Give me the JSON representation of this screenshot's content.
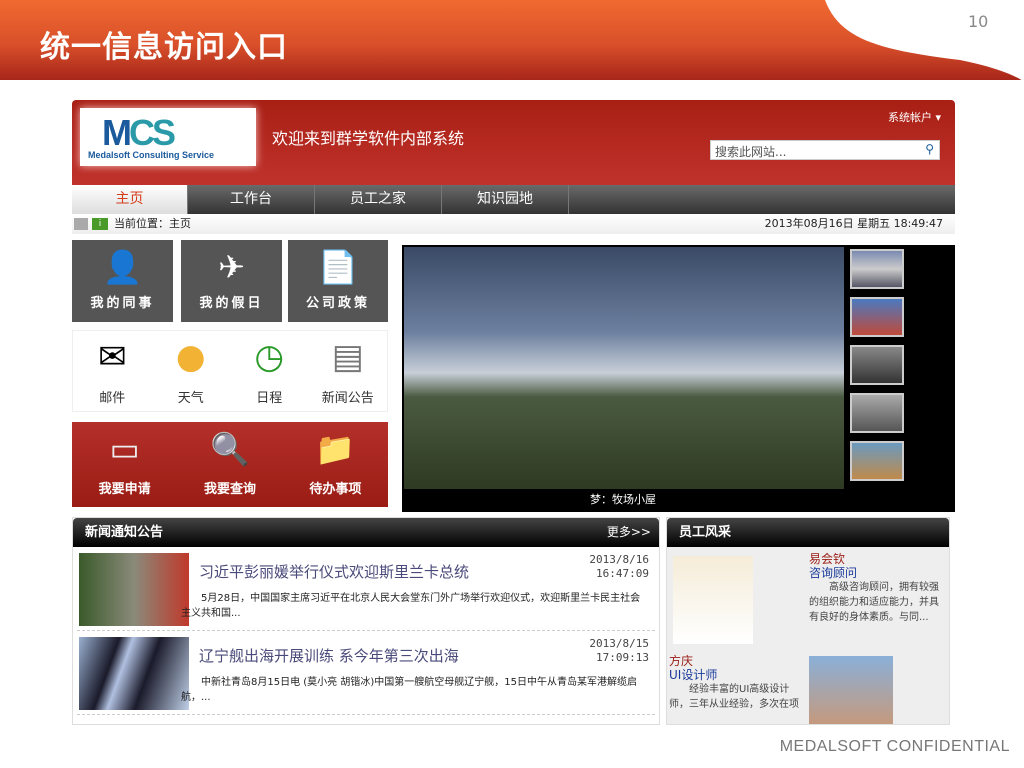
{
  "slide": {
    "title": "统一信息访问入口",
    "page_number": "10",
    "footer": "MEDALSOFT CONFIDENTIAL"
  },
  "header": {
    "logo_text": "Medalsoft Consulting Service",
    "welcome": "欢迎来到群学软件内部系统",
    "account": "系统帐户 ▾",
    "search_placeholder": "搜索此网站..."
  },
  "nav": [
    "主页",
    "工作台",
    "员工之家",
    "知识园地"
  ],
  "breadcrumb": {
    "location": "当前位置：主页",
    "datetime": "2013年08月16日 星期五 18:49:47"
  },
  "tiles": [
    {
      "label": "我的同事",
      "icon": "person-icon"
    },
    {
      "label": "我的假日",
      "icon": "airplane-icon"
    },
    {
      "label": "公司政策",
      "icon": "document-icon"
    }
  ],
  "apps": [
    {
      "label": "邮件"
    },
    {
      "label": "天气"
    },
    {
      "label": "日程"
    },
    {
      "label": "新闻公告"
    }
  ],
  "actions": [
    {
      "label": "我要申请"
    },
    {
      "label": "我要查询"
    },
    {
      "label": "待办事项"
    }
  ],
  "slideshow": {
    "caption": "梦：牧场小屋"
  },
  "news": {
    "title": "新闻通知公告",
    "more": "更多>>",
    "items": [
      {
        "title": "习近平彭丽媛举行仪式欢迎斯里兰卡总统",
        "date": "2013/8/16",
        "time": "16:47:09",
        "summary": "5月28日，中国国家主席习近平在北京人民大会堂东门外广场举行欢迎仪式，欢迎斯里兰卡民主社会主义共和国..."
      },
      {
        "title": "辽宁舰出海开展训练 系今年第三次出海",
        "date": "2013/8/15",
        "time": "17:09:13",
        "summary": "中新社青岛8月15日电 (莫小亮 胡锴冰)中国第一艘航空母舰辽宁舰，15日中午从青岛某军港解缆启航，..."
      }
    ]
  },
  "staff": {
    "title": "员工风采",
    "people": [
      {
        "name": "易会钦",
        "role": "咨询顾问",
        "desc": "高级咨询顾问，拥有较强的组织能力和适应能力，并具有良好的身体素质。与同..."
      },
      {
        "name": "方庆",
        "role": "UI设计师",
        "desc": "经验丰富的UI高级设计师，三年从业经验，多次在项"
      }
    ]
  }
}
